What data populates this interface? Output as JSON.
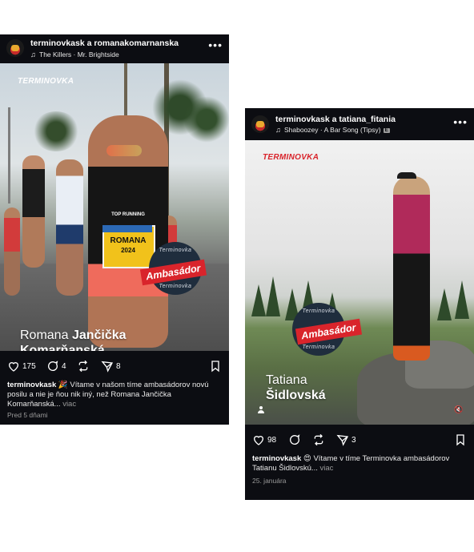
{
  "posts": [
    {
      "header": {
        "users": "terminovkask a romanakomarnanska",
        "music": "The Killers · Mr. Brightside"
      },
      "media": {
        "brand": "TERMINOVKA",
        "badge_top": "Terminovka",
        "badge_bottom": "Terminovka",
        "badge_label": "Ambasádor",
        "name_first": "Romana",
        "name_middle": "Jančička",
        "name_last": "Komarňanská",
        "bib_name": "ROMANA",
        "bib_year": "2024",
        "shirt_brand": "TOP RUNNING"
      },
      "actions": {
        "likes": "175",
        "comments": "4",
        "shares": "8"
      },
      "caption": {
        "username": "terminovkask",
        "emoji": "🎉",
        "text": "Vítame v našom tíme ambasádorov novú posilu a nie je ňou nik iný, než Romana Jančička Komarňanská...",
        "more": "viac"
      },
      "date": "Pred 5 dňami"
    },
    {
      "header": {
        "users": "terminovkask a tatiana_fitania",
        "music": "Shaboozey · A Bar Song (Tipsy)",
        "explicit": "E"
      },
      "media": {
        "brand": "TERMINOVKA",
        "badge_top": "Terminovka",
        "badge_bottom": "Terminovka",
        "badge_label": "Ambasádor",
        "name_first": "Tatiana",
        "name_last": "Šidlovská"
      },
      "actions": {
        "likes": "98",
        "shares": "3"
      },
      "caption": {
        "username": "terminovkask",
        "emoji": "😍",
        "text": "Vítame v tíme Terminovka ambasádorov Tatianu Šidlovskú...",
        "more": "viac"
      },
      "date": "25. januára"
    }
  ],
  "icons": {
    "avatar": "terminovka-logo-avatar",
    "music": "music-note-icon",
    "more": "more-dots-icon",
    "user_tag": "person-tag-icon",
    "mute": "speaker-muted-icon",
    "like": "heart-icon",
    "comment": "comment-icon",
    "repost": "repost-icon",
    "share": "send-icon",
    "save": "bookmark-icon"
  }
}
